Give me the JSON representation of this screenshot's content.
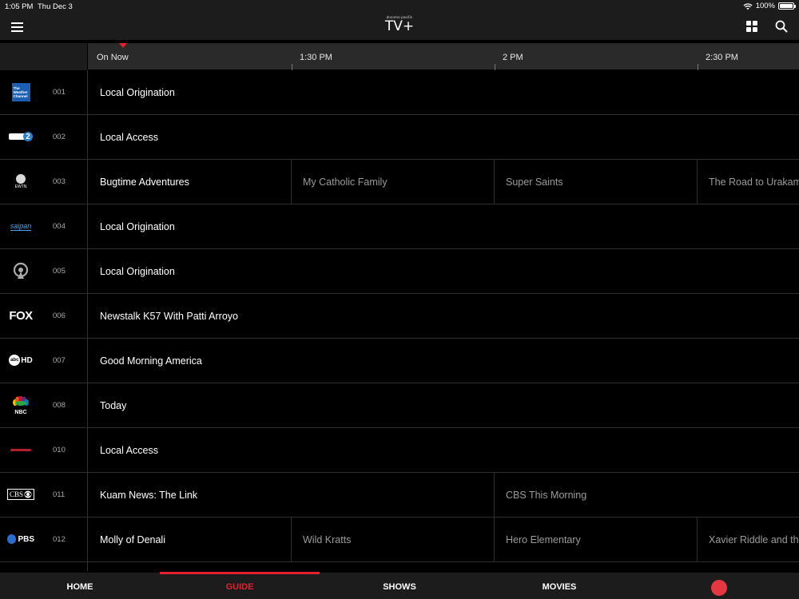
{
  "status": {
    "time": "1:05 PM",
    "date": "Thu Dec 3",
    "battery": "100%",
    "wifi_icon": "wifi-icon",
    "battery_level": 1.0
  },
  "header": {
    "brand_small": "docomo pacific",
    "brand": "TV+",
    "menu_icon": "hamburger-icon",
    "grid_icon": "grid-icon",
    "search_icon": "search-icon"
  },
  "timeline": {
    "slots": [
      "On Now",
      "1:30 PM",
      "2 PM",
      "2:30 PM"
    ]
  },
  "colors": {
    "accent": "#e5202f",
    "background": "#000000",
    "bar": "#1c1c1c",
    "timeline": "#2a2a2a"
  },
  "channels": [
    {
      "num": "001",
      "logo": "The Weather Channel",
      "logo_text": [
        "The",
        "Weather",
        "Channel"
      ],
      "programs": [
        "Local Origination"
      ]
    },
    {
      "num": "002",
      "logo": "Channel 2",
      "logo_text": "2",
      "programs": [
        "Local Access"
      ]
    },
    {
      "num": "003",
      "logo": "EWTN",
      "logo_text": "EWTN",
      "programs": [
        "Bugtime Adventures",
        "My Catholic Family",
        "Super Saints",
        "The Road to Urakami"
      ]
    },
    {
      "num": "004",
      "logo": "Saipan",
      "logo_text": "saipan",
      "programs": [
        "Local Origination"
      ]
    },
    {
      "num": "005",
      "logo": "broadcast",
      "logo_text": "",
      "programs": [
        "Local Origination"
      ]
    },
    {
      "num": "006",
      "logo": "FOX",
      "logo_text": "FOX",
      "programs": [
        "Newstalk K57 With Patti Arroyo"
      ]
    },
    {
      "num": "007",
      "logo": "abc HD",
      "logo_text": [
        "abc",
        "HD"
      ],
      "programs": [
        "Good Morning America"
      ]
    },
    {
      "num": "008",
      "logo": "NBC",
      "logo_text": "NBC",
      "programs": [
        "Today"
      ]
    },
    {
      "num": "010",
      "logo": "local",
      "logo_text": "",
      "programs": [
        "Local Access"
      ]
    },
    {
      "num": "011",
      "logo": "CBS",
      "logo_text": "CBS",
      "programs": [
        "Kuam News: The Link",
        "CBS This Morning"
      ]
    },
    {
      "num": "012",
      "logo": "PBS",
      "logo_text": "PBS",
      "programs": [
        "Molly of Denali",
        "Wild Kratts",
        "Hero Elementary",
        "Xavier Riddle and the Secret Museum"
      ]
    }
  ],
  "tabs": [
    "HOME",
    "GUIDE",
    "SHOWS",
    "MOVIES"
  ],
  "active_tab": "GUIDE",
  "record_icon": "record-icon"
}
